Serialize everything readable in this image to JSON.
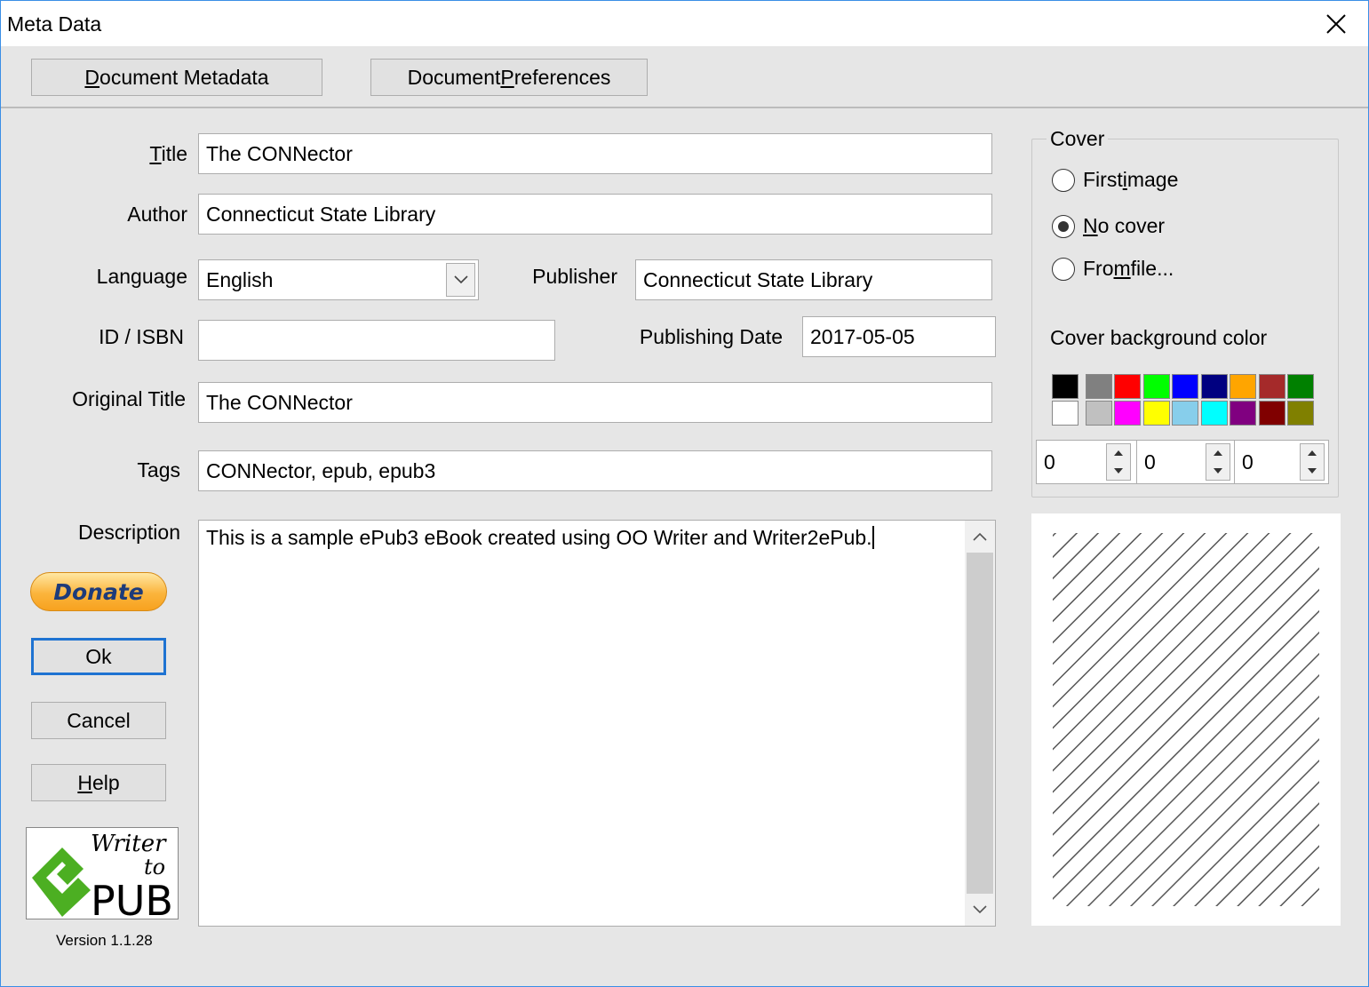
{
  "window": {
    "title": "Meta Data",
    "close_glyph": "✕"
  },
  "toolbar": {
    "metadata_pre": "",
    "metadata_key": "D",
    "metadata_post": "ocument Metadata",
    "preferences_pre": "Document ",
    "preferences_key": "P",
    "preferences_post": "references"
  },
  "form": {
    "title_label_pre": "",
    "title_label_key": "T",
    "title_label_post": "itle",
    "title_value": "The CONNector",
    "author_label": "Author",
    "author_value": "Connecticut State Library",
    "language_label": "Language",
    "language_value": "English",
    "publisher_label": "Publisher",
    "publisher_value": "Connecticut State Library",
    "id_label": "ID / ISBN",
    "id_value": "",
    "pubdate_label": "Publishing Date",
    "pubdate_value": "2017-05-05",
    "original_title_label": "Original Title",
    "original_title_value": "The CONNector",
    "tags_label_pre": "Ta",
    "tags_label_key": "g",
    "tags_label_post": "s",
    "tags_value": "CONNector, epub, epub3",
    "description_label": "Description",
    "description_value": "This is a sample ePub3 eBook created using OO Writer and Writer2ePub."
  },
  "cover": {
    "legend": "Cover",
    "first_image_pre": "First ",
    "first_image_key": "i",
    "first_image_post": "mage",
    "no_cover_pre": "",
    "no_cover_key": "N",
    "no_cover_post": "o cover",
    "from_file_pre": "Fro",
    "from_file_key": "m",
    "from_file_post": " file...",
    "selected": "no_cover",
    "bg_color_label": "Cover background color",
    "palette_top": [
      "#000000",
      "#808080",
      "#ff0000",
      "#00ff00",
      "#0000ff",
      "#000080",
      "#ffa500",
      "#a52a2a",
      "#008000"
    ],
    "palette_bottom": [
      "#ffffff",
      "#c0c0c0",
      "#ff00ff",
      "#ffff00",
      "#87ceeb",
      "#00ffff",
      "#800080",
      "#800000",
      "#808000"
    ],
    "rgb": [
      "0",
      "0",
      "0"
    ]
  },
  "buttons": {
    "donate": "Donate",
    "ok": "Ok",
    "cancel": "Cancel",
    "help_pre": "",
    "help_key": "H",
    "help_post": "elp"
  },
  "logo": {
    "line1": "Writer",
    "line2": "to",
    "line3": "PUB",
    "colors": {
      "green": "#4caf22",
      "dark": "#000000"
    }
  },
  "version": "Version 1.1.28",
  "colors": {
    "accent": "#3a8ee6",
    "dialog_bg": "#e6e6e6",
    "ok_border": "#1e73d2"
  }
}
